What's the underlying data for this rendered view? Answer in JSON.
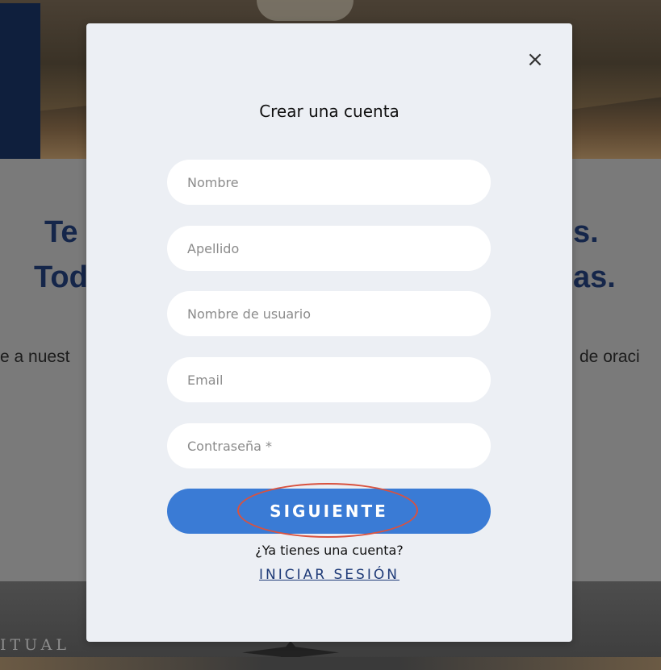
{
  "background": {
    "heading_line1_left": "Te",
    "heading_line1_right": "s.",
    "heading_line2_left": "Tod",
    "heading_line2_right": "as.",
    "para_left": "e a nuest",
    "para_right": "de oraci",
    "footer_text": "ITUAL"
  },
  "modal": {
    "title": "Crear una cuenta",
    "close_glyph": "×",
    "fields": {
      "first_name_placeholder": "Nombre",
      "last_name_placeholder": "Apellido",
      "username_placeholder": "Nombre de usuario",
      "email_placeholder": "Email",
      "password_placeholder": "Contraseña *"
    },
    "next_button_label": "SIGUIENTE",
    "have_account_text": "¿Ya tienes una cuenta?",
    "login_link_label": "INICIAR SESIÓN"
  },
  "colors": {
    "accent": "#3a7bd5",
    "modal_background": "#eceff4",
    "link": "#1f3b78",
    "annotation": "#d9523f"
  }
}
